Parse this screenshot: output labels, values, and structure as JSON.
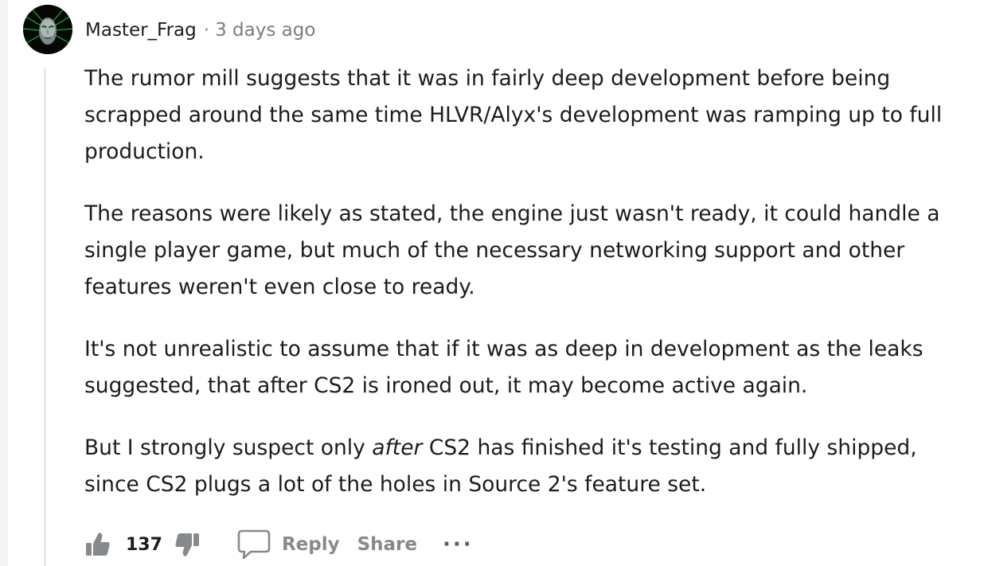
{
  "comment": {
    "username": "Master_Frag",
    "separator": "·",
    "timestamp": "3 days ago",
    "paragraphs": [
      "The rumor mill suggests that it was in fairly deep development before being scrapped around the same time HLVR/Alyx's development was ramping up to full production.",
      "The reasons were likely as stated, the engine just wasn't ready, it could handle a single player game, but much of the necessary networking support and other features weren't even close to ready.",
      "It's not unrealistic to assume that if it was as deep in development as the leaks suggested, that after CS2 is ironed out, it may become active again."
    ],
    "last_paragraph": {
      "before": "But I strongly suspect only ",
      "emphasis": "after",
      "after": " CS2 has finished it's testing and fully shipped, since CS2 plugs a lot of the holes in Source 2's feature set."
    }
  },
  "actions": {
    "score": "137",
    "reply_label": "Reply",
    "share_label": "Share",
    "more_label": "···"
  },
  "icons": {
    "upvote": "thumbs-up-icon",
    "downvote": "thumbs-down-icon",
    "reply": "speech-bubble-icon",
    "avatar": "green-face-avatar"
  },
  "colors": {
    "text": "#1c1c1c",
    "meta": "#7c7c7c",
    "action": "#878a8c",
    "thread_line": "#e6e8ea"
  }
}
